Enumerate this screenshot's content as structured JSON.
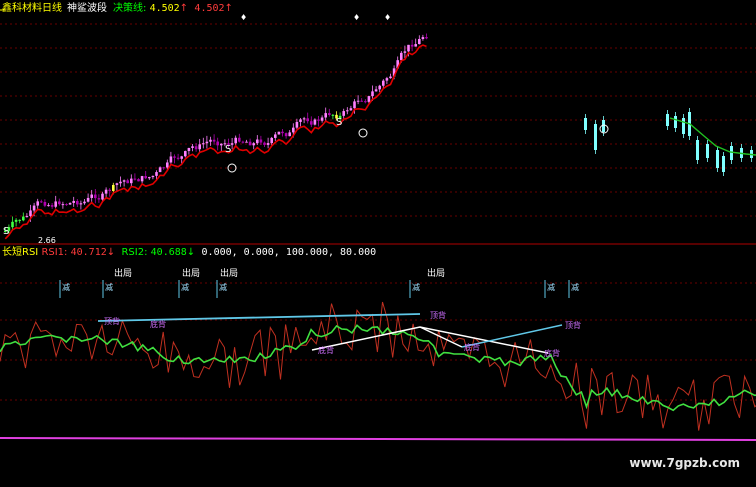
{
  "header": {
    "stock_name": "鑫科材料",
    "period": "日线",
    "indicator": "神鲨波段",
    "line_label": "决策线:",
    "value_1": "4.502",
    "value_2": "4.502"
  },
  "indicator_panel": {
    "name": "长短RSI",
    "rsi1_label": "RSI1:",
    "rsi1_value": "40.712",
    "rsi2_label": "RSI2:",
    "rsi2_value": "40.688",
    "params": "0.000, 0.000, 100.000, 80.000"
  },
  "annotations": {
    "exit_label": "出局",
    "reduce_label": "减",
    "top_div_label": "顶背",
    "bottom_div_label": "底背",
    "buy_label": "S",
    "price_low": "2.66"
  },
  "watermark": "www.7gpzb.com",
  "colors": {
    "up_candle": "#ff80ff",
    "down_candle": "#80ffff",
    "ma_red": "#e00000",
    "ma_green": "#20c020",
    "rsi_green": "#40e040",
    "rsi_red": "#c03020",
    "div_line_cyan": "#60c8e8",
    "div_line_white": "#ffffff",
    "baseline_magenta": "#e040e0",
    "grid_red": "#8b0000"
  }
}
